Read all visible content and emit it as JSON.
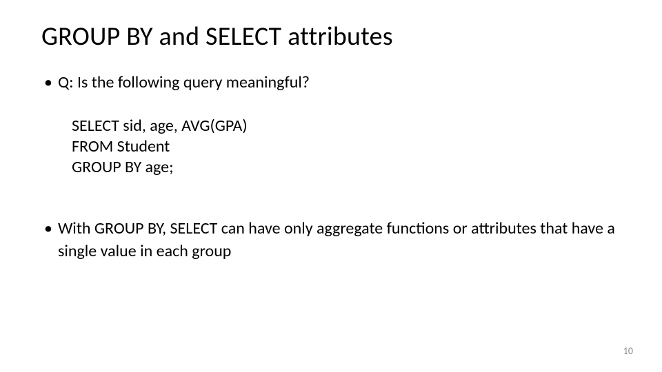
{
  "title": "GROUP BY and SELECT attributes",
  "bullets": {
    "b1": "Q: Is the following query meaningful?",
    "b2": "With GROUP BY, SELECT can have only aggregate functions or attributes that have a single value in each group"
  },
  "code": {
    "l1": "SELECT sid, age, AVG(GPA)",
    "l2": "FROM Student",
    "l3": "GROUP BY age;"
  },
  "page_number": "10",
  "bullet_glyph": "•"
}
